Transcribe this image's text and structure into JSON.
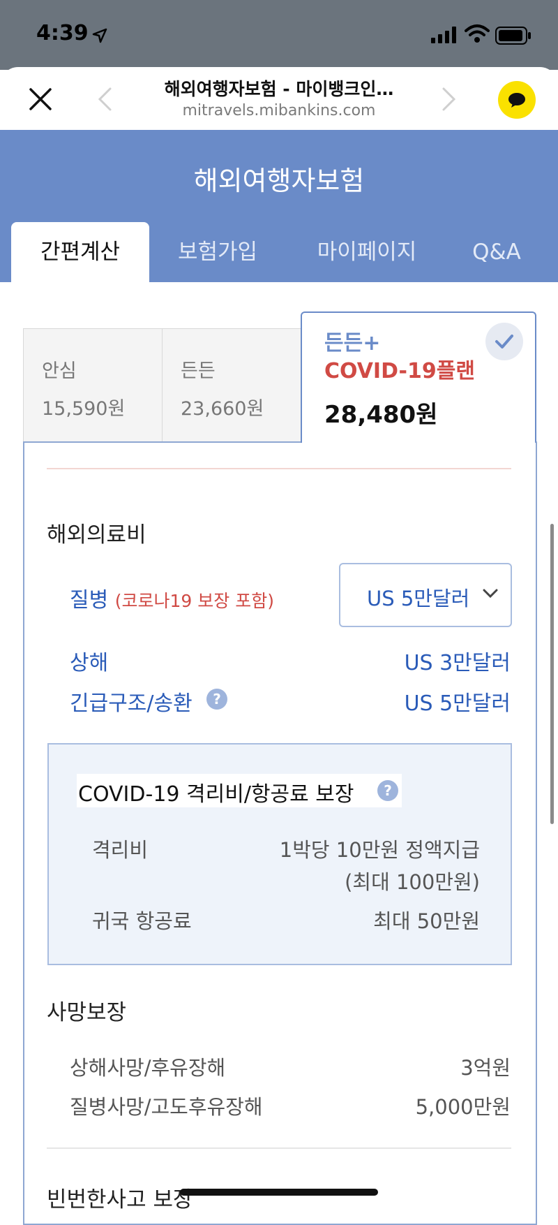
{
  "status": {
    "time": "4:39"
  },
  "browser": {
    "title": "해외여행자보험 - 마이뱅크인…",
    "url": "mitravels.mibankins.com"
  },
  "header": {
    "title": "해외여행자보험",
    "tabs": [
      {
        "label": "간편계산",
        "active": true
      },
      {
        "label": "보험가입"
      },
      {
        "label": "마이페이지"
      },
      {
        "label": "Q&A"
      }
    ]
  },
  "plans": [
    {
      "name": "안심",
      "price": "15,590원"
    },
    {
      "name": "든든",
      "price": "23,660원"
    },
    {
      "name_line1": "든든+",
      "name_line2": "COVID-19플랜",
      "price": "28,480원",
      "selected": true
    }
  ],
  "medical": {
    "title": "해외의료비",
    "illness_label": "질병",
    "illness_note": "(코로나19 보장 포함)",
    "illness_selected": "US 5만달러",
    "injury_label": "상해",
    "injury_value": "US 3만달러",
    "rescue_label": "긴급구조/송환",
    "rescue_value": "US 5만달러"
  },
  "covid": {
    "title": "COVID-19 격리비/항공료 보장",
    "quarantine_label": "격리비",
    "quarantine_value_1": "1박당 10만원 정액지급",
    "quarantine_value_2": "(최대 100만원)",
    "airfare_label": "귀국 항공료",
    "airfare_value": "최대 50만원"
  },
  "death": {
    "title": "사망보장",
    "injury_label": "상해사망/후유장해",
    "injury_value": "3억원",
    "illness_label": "질병사망/고도후유장해",
    "illness_value": "5,000만원"
  },
  "next_section": {
    "title": "빈번한사고 보장"
  },
  "colors": {
    "header": "#6a8bc8",
    "accent_blue": "#2a5bb8",
    "accent_red": "#d04a44",
    "kakao": "#fae100"
  }
}
